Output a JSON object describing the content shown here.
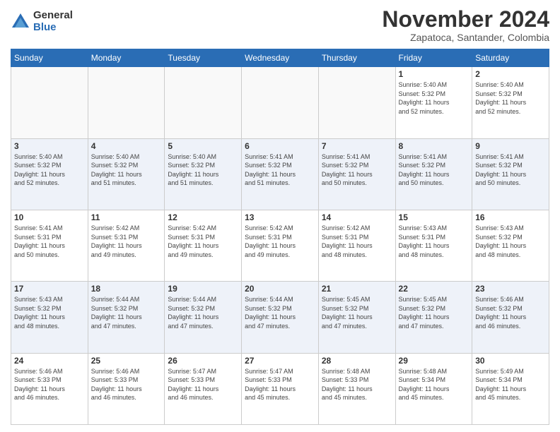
{
  "logo": {
    "general": "General",
    "blue": "Blue"
  },
  "title": "November 2024",
  "location": "Zapatoca, Santander, Colombia",
  "days_of_week": [
    "Sunday",
    "Monday",
    "Tuesday",
    "Wednesday",
    "Thursday",
    "Friday",
    "Saturday"
  ],
  "weeks": [
    [
      {
        "day": "",
        "info": ""
      },
      {
        "day": "",
        "info": ""
      },
      {
        "day": "",
        "info": ""
      },
      {
        "day": "",
        "info": ""
      },
      {
        "day": "",
        "info": ""
      },
      {
        "day": "1",
        "info": "Sunrise: 5:40 AM\nSunset: 5:32 PM\nDaylight: 11 hours\nand 52 minutes."
      },
      {
        "day": "2",
        "info": "Sunrise: 5:40 AM\nSunset: 5:32 PM\nDaylight: 11 hours\nand 52 minutes."
      }
    ],
    [
      {
        "day": "3",
        "info": "Sunrise: 5:40 AM\nSunset: 5:32 PM\nDaylight: 11 hours\nand 52 minutes."
      },
      {
        "day": "4",
        "info": "Sunrise: 5:40 AM\nSunset: 5:32 PM\nDaylight: 11 hours\nand 51 minutes."
      },
      {
        "day": "5",
        "info": "Sunrise: 5:40 AM\nSunset: 5:32 PM\nDaylight: 11 hours\nand 51 minutes."
      },
      {
        "day": "6",
        "info": "Sunrise: 5:41 AM\nSunset: 5:32 PM\nDaylight: 11 hours\nand 51 minutes."
      },
      {
        "day": "7",
        "info": "Sunrise: 5:41 AM\nSunset: 5:32 PM\nDaylight: 11 hours\nand 50 minutes."
      },
      {
        "day": "8",
        "info": "Sunrise: 5:41 AM\nSunset: 5:32 PM\nDaylight: 11 hours\nand 50 minutes."
      },
      {
        "day": "9",
        "info": "Sunrise: 5:41 AM\nSunset: 5:32 PM\nDaylight: 11 hours\nand 50 minutes."
      }
    ],
    [
      {
        "day": "10",
        "info": "Sunrise: 5:41 AM\nSunset: 5:31 PM\nDaylight: 11 hours\nand 50 minutes."
      },
      {
        "day": "11",
        "info": "Sunrise: 5:42 AM\nSunset: 5:31 PM\nDaylight: 11 hours\nand 49 minutes."
      },
      {
        "day": "12",
        "info": "Sunrise: 5:42 AM\nSunset: 5:31 PM\nDaylight: 11 hours\nand 49 minutes."
      },
      {
        "day": "13",
        "info": "Sunrise: 5:42 AM\nSunset: 5:31 PM\nDaylight: 11 hours\nand 49 minutes."
      },
      {
        "day": "14",
        "info": "Sunrise: 5:42 AM\nSunset: 5:31 PM\nDaylight: 11 hours\nand 48 minutes."
      },
      {
        "day": "15",
        "info": "Sunrise: 5:43 AM\nSunset: 5:31 PM\nDaylight: 11 hours\nand 48 minutes."
      },
      {
        "day": "16",
        "info": "Sunrise: 5:43 AM\nSunset: 5:32 PM\nDaylight: 11 hours\nand 48 minutes."
      }
    ],
    [
      {
        "day": "17",
        "info": "Sunrise: 5:43 AM\nSunset: 5:32 PM\nDaylight: 11 hours\nand 48 minutes."
      },
      {
        "day": "18",
        "info": "Sunrise: 5:44 AM\nSunset: 5:32 PM\nDaylight: 11 hours\nand 47 minutes."
      },
      {
        "day": "19",
        "info": "Sunrise: 5:44 AM\nSunset: 5:32 PM\nDaylight: 11 hours\nand 47 minutes."
      },
      {
        "day": "20",
        "info": "Sunrise: 5:44 AM\nSunset: 5:32 PM\nDaylight: 11 hours\nand 47 minutes."
      },
      {
        "day": "21",
        "info": "Sunrise: 5:45 AM\nSunset: 5:32 PM\nDaylight: 11 hours\nand 47 minutes."
      },
      {
        "day": "22",
        "info": "Sunrise: 5:45 AM\nSunset: 5:32 PM\nDaylight: 11 hours\nand 47 minutes."
      },
      {
        "day": "23",
        "info": "Sunrise: 5:46 AM\nSunset: 5:32 PM\nDaylight: 11 hours\nand 46 minutes."
      }
    ],
    [
      {
        "day": "24",
        "info": "Sunrise: 5:46 AM\nSunset: 5:33 PM\nDaylight: 11 hours\nand 46 minutes."
      },
      {
        "day": "25",
        "info": "Sunrise: 5:46 AM\nSunset: 5:33 PM\nDaylight: 11 hours\nand 46 minutes."
      },
      {
        "day": "26",
        "info": "Sunrise: 5:47 AM\nSunset: 5:33 PM\nDaylight: 11 hours\nand 46 minutes."
      },
      {
        "day": "27",
        "info": "Sunrise: 5:47 AM\nSunset: 5:33 PM\nDaylight: 11 hours\nand 45 minutes."
      },
      {
        "day": "28",
        "info": "Sunrise: 5:48 AM\nSunset: 5:33 PM\nDaylight: 11 hours\nand 45 minutes."
      },
      {
        "day": "29",
        "info": "Sunrise: 5:48 AM\nSunset: 5:34 PM\nDaylight: 11 hours\nand 45 minutes."
      },
      {
        "day": "30",
        "info": "Sunrise: 5:49 AM\nSunset: 5:34 PM\nDaylight: 11 hours\nand 45 minutes."
      }
    ]
  ]
}
